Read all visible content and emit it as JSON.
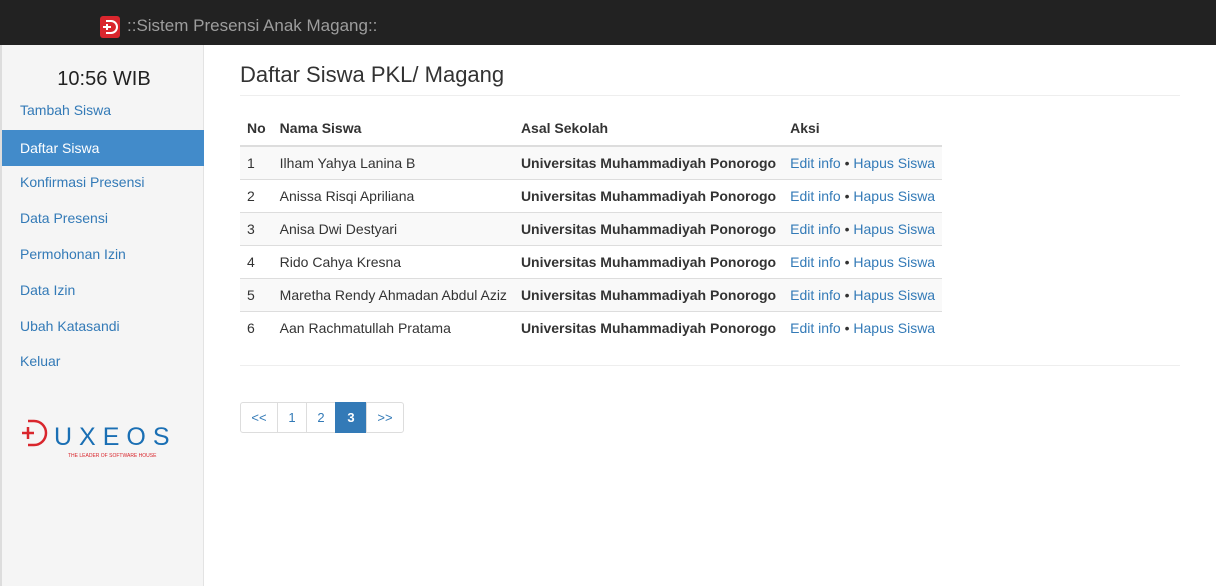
{
  "header": {
    "app_title": "::Sistem Presensi Anak Magang::",
    "brand_icon": "duxeos-icon"
  },
  "sidebar": {
    "clock": "10:56 WIB",
    "items": [
      {
        "label": "Tambah Siswa"
      },
      {
        "label": "Daftar Siswa",
        "active": true
      },
      {
        "label": "Konfirmasi Presensi"
      },
      {
        "label": "Data Presensi"
      },
      {
        "label": "Permohonan Izin"
      },
      {
        "label": "Data Izin"
      },
      {
        "label": "Ubah Katasandi"
      },
      {
        "label": "Keluar"
      }
    ],
    "logo": {
      "name": "UXEOS",
      "tagline": "THE LEADER OF SOFTWARE HOUSE"
    }
  },
  "main": {
    "title": "Daftar Siswa PKL/ Magang",
    "table": {
      "headers": [
        "No",
        "Nama Siswa",
        "Asal Sekolah",
        "Aksi"
      ],
      "rows": [
        {
          "no": "1",
          "name": "Ilham Yahya Lanina B",
          "school": "Universitas Muhammadiyah Ponorogo"
        },
        {
          "no": "2",
          "name": "Anissa Risqi Apriliana",
          "school": "Universitas Muhammadiyah Ponorogo"
        },
        {
          "no": "3",
          "name": "Anisa Dwi Destyari",
          "school": "Universitas Muhammadiyah Ponorogo"
        },
        {
          "no": "4",
          "name": "Rido Cahya Kresna",
          "school": "Universitas Muhammadiyah Ponorogo"
        },
        {
          "no": "5",
          "name": "Maretha Rendy Ahmadan Abdul Aziz",
          "school": "Universitas Muhammadiyah Ponorogo"
        },
        {
          "no": "6",
          "name": "Aan Rachmatullah Pratama",
          "school": "Universitas Muhammadiyah Ponorogo"
        }
      ],
      "action_edit": "Edit info",
      "action_separator": "•",
      "action_delete": "Hapus Siswa"
    },
    "pagination": {
      "prev": "<<",
      "pages": [
        "1",
        "2",
        "3"
      ],
      "current": "3",
      "next": ">>"
    }
  },
  "colors": {
    "topbar": "#222222",
    "accent": "#337ab7",
    "active_nav": "#428bca",
    "brand_red": "#d9262d"
  }
}
